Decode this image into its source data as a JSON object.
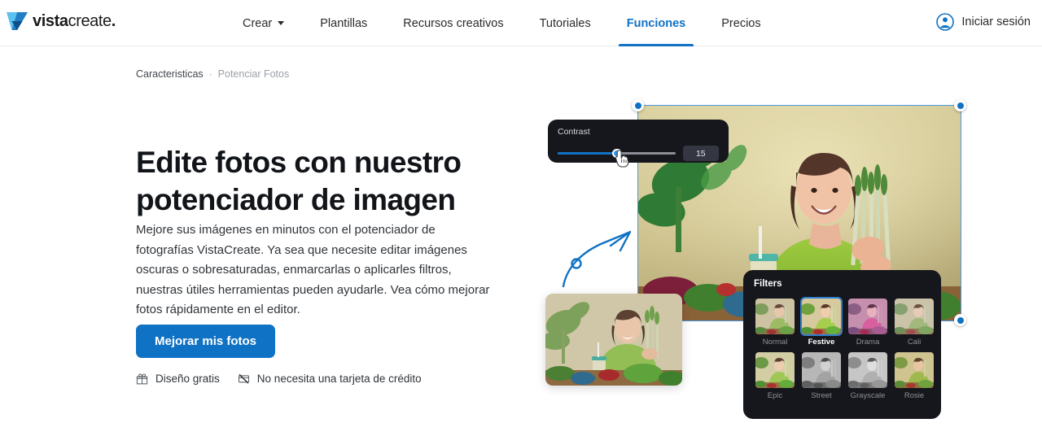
{
  "brand": {
    "name_bold": "vista",
    "name_thin": "create",
    "name_dot": ".",
    "logo_color_light": "#5bc2f0",
    "logo_color_dark": "#1f7ec4",
    "accent": "#1072c4"
  },
  "nav": {
    "items": [
      {
        "label": "Crear",
        "has_caret": true,
        "active": false
      },
      {
        "label": "Plantillas",
        "has_caret": false,
        "active": false
      },
      {
        "label": "Recursos creativos",
        "has_caret": false,
        "active": false
      },
      {
        "label": "Tutoriales",
        "has_caret": false,
        "active": false
      },
      {
        "label": "Funciones",
        "has_caret": false,
        "active": true
      },
      {
        "label": "Precios",
        "has_caret": false,
        "active": false
      }
    ],
    "login_label": "Iniciar sesión",
    "login_icon": "user-circle-icon"
  },
  "breadcrumb": {
    "parent": "Caracteristicas",
    "separator": "·",
    "current": "Potenciar Fotos"
  },
  "hero": {
    "title": "Edite fotos con nuestro potenciador de imagen",
    "description": "Mejore sus imágenes en minutos con el potenciador de fotografías VistaCreate. Ya sea que necesite editar imágenes oscuras o sobresaturadas, enmarcarlas o aplicarles filtros, nuestras útiles herramientas pueden ayudarle. Vea cómo mejorar fotos rápidamente en el editor.",
    "cta_label": "Mejorar mis fotos",
    "perks": [
      {
        "icon": "gift-icon",
        "label": "Diseño gratis"
      },
      {
        "icon": "no-credit-card-icon",
        "label": "No necesita una tarjeta de crédito"
      }
    ]
  },
  "editor": {
    "contrast": {
      "label": "Contrast",
      "value": "15",
      "fill_percent": 47,
      "cursor": "pointer-hand-cursor"
    },
    "selection_handles": [
      "top-left",
      "top-right",
      "bottom-right"
    ],
    "filters": {
      "title": "Filters",
      "selected": "Festive",
      "items": [
        {
          "name": "Normal",
          "selected": false
        },
        {
          "name": "Festive",
          "selected": true
        },
        {
          "name": "Drama",
          "selected": false
        },
        {
          "name": "Cali",
          "selected": false
        },
        {
          "name": "Epic",
          "selected": false
        },
        {
          "name": "Street",
          "selected": false
        },
        {
          "name": "Grayscale",
          "selected": false
        },
        {
          "name": "Rosie",
          "selected": false
        }
      ]
    }
  }
}
